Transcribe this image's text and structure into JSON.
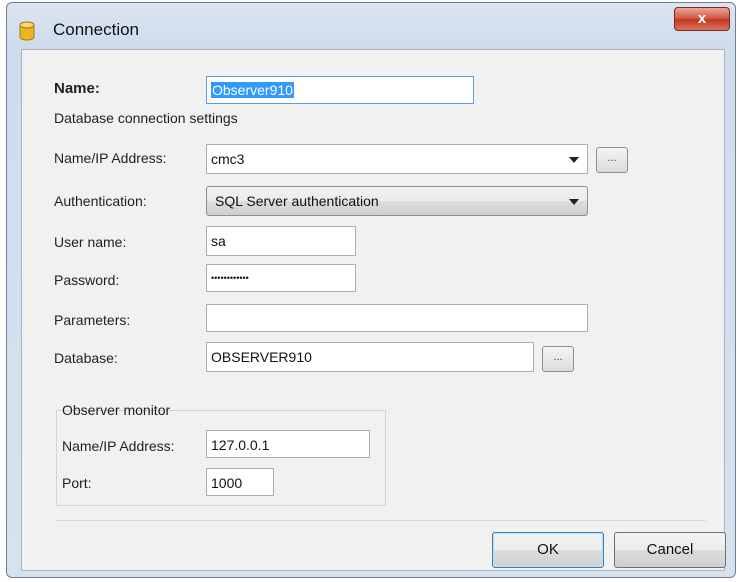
{
  "window": {
    "title": "Connection",
    "close_label": "x"
  },
  "form": {
    "name_label": "Name:",
    "name_value": "Observer910",
    "section_label": "Database connection settings",
    "address_label": "Name/IP Address:",
    "address_value": "cmc3",
    "browse_label": "...",
    "auth_label": "Authentication:",
    "auth_value": "SQL Server authentication",
    "user_label": "User name:",
    "user_value": "sa",
    "password_label": "Password:",
    "password_value": "••••••••••••",
    "params_label": "Parameters:",
    "params_value": "",
    "database_label": "Database:",
    "database_value": "OBSERVER910"
  },
  "monitor": {
    "group_label": "Observer monitor",
    "address_label": "Name/IP Address:",
    "address_value": "127.0.0.1",
    "port_label": "Port:",
    "port_value": "1000"
  },
  "buttons": {
    "ok": "OK",
    "cancel": "Cancel"
  }
}
